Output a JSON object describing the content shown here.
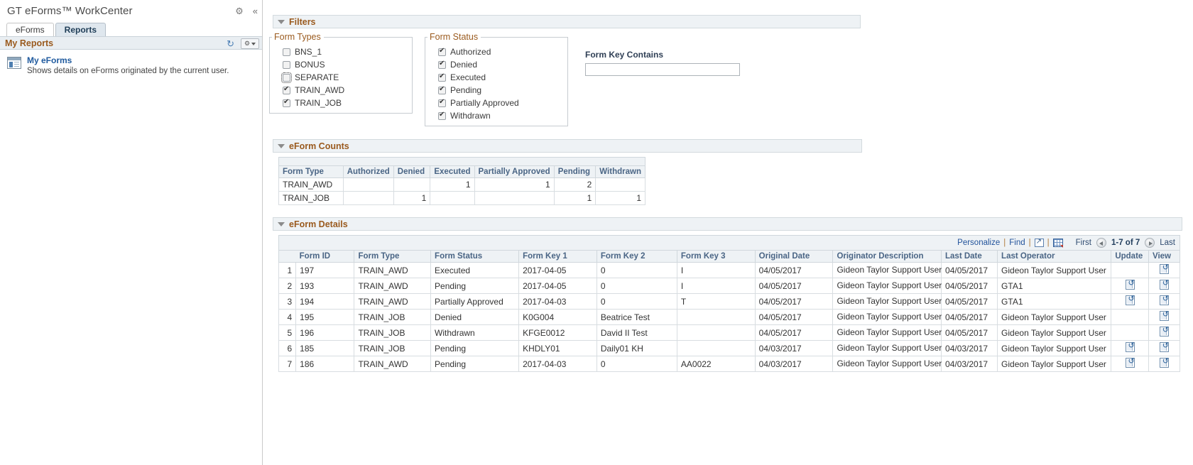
{
  "workcenter": {
    "title": "GT eForms™ WorkCenter",
    "gear_icon": "gear-icon",
    "collapse_icon": "double-chevron-left-icon",
    "tabs": [
      {
        "label": "eForms",
        "active": false
      },
      {
        "label": "Reports",
        "active": true
      }
    ],
    "pagelet": {
      "title": "My Reports",
      "refresh_icon": "refresh-icon",
      "options_icon": "gear-icon",
      "report": {
        "link": "My eForms",
        "description": "Shows details on eForms originated by the current user.",
        "icon": "report-document-icon"
      }
    }
  },
  "filters": {
    "section_title": "Filters",
    "form_types": {
      "legend": "Form Types",
      "items": [
        {
          "label": "BNS_1",
          "checked": false,
          "focused": false
        },
        {
          "label": "BONUS",
          "checked": false,
          "focused": false
        },
        {
          "label": "SEPARATE",
          "checked": false,
          "focused": true
        },
        {
          "label": "TRAIN_AWD",
          "checked": true,
          "focused": false
        },
        {
          "label": "TRAIN_JOB",
          "checked": true,
          "focused": false
        }
      ]
    },
    "form_status": {
      "legend": "Form Status",
      "items": [
        {
          "label": "Authorized",
          "checked": true
        },
        {
          "label": "Denied",
          "checked": true
        },
        {
          "label": "Executed",
          "checked": true
        },
        {
          "label": "Pending",
          "checked": true
        },
        {
          "label": "Partially Approved",
          "checked": true
        },
        {
          "label": "Withdrawn",
          "checked": true
        }
      ]
    },
    "form_key_contains": {
      "label": "Form Key Contains",
      "value": "",
      "placeholder": ""
    }
  },
  "counts": {
    "section_title": "eForm Counts",
    "columns": [
      "Form Type",
      "Authorized",
      "Denied",
      "Executed",
      "Partially Approved",
      "Pending",
      "Withdrawn"
    ],
    "rows": [
      {
        "form_type": "TRAIN_AWD",
        "authorized": "",
        "denied": "",
        "executed": "1",
        "partially_approved": "1",
        "pending": "2",
        "withdrawn": ""
      },
      {
        "form_type": "TRAIN_JOB",
        "authorized": "",
        "denied": "1",
        "executed": "",
        "partially_approved": "",
        "pending": "1",
        "withdrawn": "1"
      }
    ]
  },
  "details": {
    "section_title": "eForm Details",
    "toolbar": {
      "personalize": "Personalize",
      "find": "Find",
      "new_window_icon": "new-window-icon",
      "download_grid_icon": "download-to-spreadsheet-icon",
      "first": "First",
      "prev_icon": "previous-page-icon",
      "range": "1-7 of 7",
      "next_icon": "next-page-icon",
      "last": "Last"
    },
    "columns": [
      "",
      "Form ID",
      "Form Type",
      "Form Status",
      "Form Key 1",
      "Form Key 2",
      "Form Key 3",
      "Original Date",
      "Originator Description",
      "Last Date",
      "Last Operator",
      "Update",
      "View"
    ],
    "rows": [
      {
        "n": "1",
        "form_id": "197",
        "form_type": "TRAIN_AWD",
        "form_status": "Executed",
        "key1": "2017-04-05",
        "key2": "0",
        "key3": "I",
        "original_date": "04/05/2017",
        "originator": "Gideon Taylor Support User",
        "last_date": "04/05/2017",
        "last_operator": "Gideon Taylor Support User",
        "update": false,
        "view": true
      },
      {
        "n": "2",
        "form_id": "193",
        "form_type": "TRAIN_AWD",
        "form_status": "Pending",
        "key1": "2017-04-05",
        "key2": "0",
        "key3": "I",
        "original_date": "04/05/2017",
        "originator": "Gideon Taylor Support User",
        "last_date": "04/05/2017",
        "last_operator": "GTA1",
        "update": true,
        "view": true
      },
      {
        "n": "3",
        "form_id": "194",
        "form_type": "TRAIN_AWD",
        "form_status": "Partially Approved",
        "key1": "2017-04-03",
        "key2": "0",
        "key3": "T",
        "original_date": "04/05/2017",
        "originator": "Gideon Taylor Support User",
        "last_date": "04/05/2017",
        "last_operator": "GTA1",
        "update": true,
        "view": true
      },
      {
        "n": "4",
        "form_id": "195",
        "form_type": "TRAIN_JOB",
        "form_status": "Denied",
        "key1": "K0G004",
        "key2": "Beatrice Test",
        "key3": "",
        "original_date": "04/05/2017",
        "originator": "Gideon Taylor Support User",
        "last_date": "04/05/2017",
        "last_operator": "Gideon Taylor Support User",
        "update": false,
        "view": true
      },
      {
        "n": "5",
        "form_id": "196",
        "form_type": "TRAIN_JOB",
        "form_status": "Withdrawn",
        "key1": "KFGE0012",
        "key2": "David II Test",
        "key3": "",
        "original_date": "04/05/2017",
        "originator": "Gideon Taylor Support User",
        "last_date": "04/05/2017",
        "last_operator": "Gideon Taylor Support User",
        "update": false,
        "view": true
      },
      {
        "n": "6",
        "form_id": "185",
        "form_type": "TRAIN_JOB",
        "form_status": "Pending",
        "key1": "KHDLY01",
        "key2": "Daily01 KH",
        "key3": "",
        "original_date": "04/03/2017",
        "originator": "Gideon Taylor Support User",
        "last_date": "04/03/2017",
        "last_operator": "Gideon Taylor Support User",
        "update": true,
        "view": true
      },
      {
        "n": "7",
        "form_id": "186",
        "form_type": "TRAIN_AWD",
        "form_status": "Pending",
        "key1": "2017-04-03",
        "key2": "0",
        "key3": "AA0022",
        "original_date": "04/03/2017",
        "originator": "Gideon Taylor Support User",
        "last_date": "04/03/2017",
        "last_operator": "Gideon Taylor Support User",
        "update": true,
        "view": true
      }
    ]
  }
}
